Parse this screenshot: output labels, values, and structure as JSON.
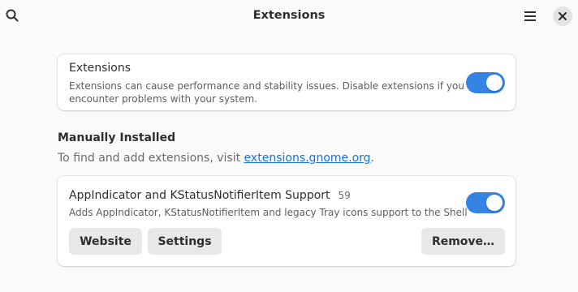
{
  "header": {
    "title": "Extensions",
    "search_icon": "search-icon",
    "menu_icon": "hamburger-menu-icon",
    "close_icon": "close-icon"
  },
  "global_toggle": {
    "title": "Extensions",
    "description_line1": "Extensions can cause performance and stability issues. Disable extensions if you",
    "description_line2": "encounter problems with your system.",
    "enabled": true
  },
  "manual": {
    "heading": "Manually Installed",
    "desc_prefix": "To find and add extensions, visit ",
    "link_text": "extensions.gnome.org",
    "desc_suffix": "."
  },
  "extension": {
    "name": "AppIndicator and KStatusNotifierItem Support",
    "version": "59",
    "description": "Adds AppIndicator, KStatusNotifierItem and legacy Tray icons support to the Shell",
    "enabled": true,
    "website_label": "Website",
    "settings_label": "Settings",
    "remove_label": "Remove…"
  },
  "colors": {
    "accent": "#3584e4",
    "link": "#1c71d8",
    "background": "#fafafa"
  }
}
